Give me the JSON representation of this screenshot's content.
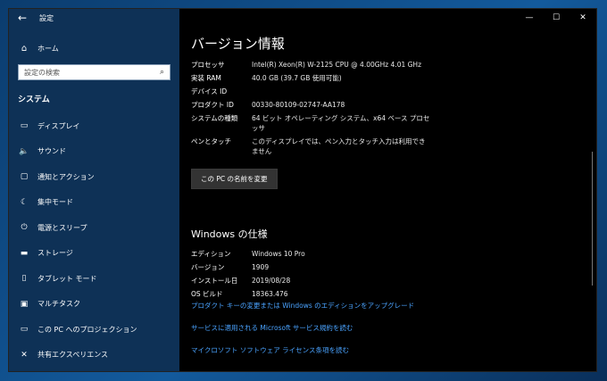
{
  "app": {
    "title": "設定"
  },
  "titlebar": {
    "back": "←",
    "minimize": "—",
    "maximize": "☐",
    "close": "✕"
  },
  "sidebar": {
    "home": "ホーム",
    "search_placeholder": "設定の検索",
    "section": "システム",
    "items": [
      {
        "icon": "display-icon",
        "glyph": "▭",
        "label": "ディスプレイ"
      },
      {
        "icon": "sound-icon",
        "glyph": "🔈",
        "label": "サウンド"
      },
      {
        "icon": "notification-icon",
        "glyph": "▢",
        "label": "通知とアクション"
      },
      {
        "icon": "focus-assist-icon",
        "glyph": "☾",
        "label": "集中モード"
      },
      {
        "icon": "power-icon",
        "glyph": "⏻",
        "label": "電源とスリープ"
      },
      {
        "icon": "storage-icon",
        "glyph": "▬",
        "label": "ストレージ"
      },
      {
        "icon": "tablet-icon",
        "glyph": "▯",
        "label": "タブレット モード"
      },
      {
        "icon": "multitask-icon",
        "glyph": "▣",
        "label": "マルチタスク"
      },
      {
        "icon": "projection-icon",
        "glyph": "▭",
        "label": "この PC へのプロジェクション"
      },
      {
        "icon": "shared-experience-icon",
        "glyph": "✕",
        "label": "共有エクスペリエンス"
      }
    ]
  },
  "version_info": {
    "title": "バージョン情報",
    "rows": [
      {
        "key": "プロセッサ",
        "value": "Intel(R) Xeon(R) W-2125 CPU @ 4.00GHz 4.01 GHz"
      },
      {
        "key": "実装 RAM",
        "value": "40.0 GB (39.7 GB 使用可能)"
      },
      {
        "key": "デバイス ID",
        "value": ""
      },
      {
        "key": "プロダクト ID",
        "value": "00330-80109-02747-AA178"
      },
      {
        "key": "システムの種類",
        "value": "64 ビット オペレーティング システム、x64 ベース プロセッサ"
      },
      {
        "key": "ペンとタッチ",
        "value": "このディスプレイでは、ペン入力とタッチ入力は利用できません"
      }
    ],
    "rename_button": "この PC の名前を変更"
  },
  "windows_spec": {
    "title": "Windows の仕様",
    "rows": [
      {
        "key": "エディション",
        "value": "Windows 10 Pro"
      },
      {
        "key": "バージョン",
        "value": "1909"
      },
      {
        "key": "インストール日",
        "value": "2019/08/28"
      },
      {
        "key": "OS ビルド",
        "value": "18363.476"
      }
    ],
    "links": [
      "プロダクト キーの変更または Windows のエディションをアップグレード",
      "サービスに適用される Microsoft サービス規約を読む",
      "マイクロソフト ソフトウェア ライセンス条項を読む"
    ]
  }
}
